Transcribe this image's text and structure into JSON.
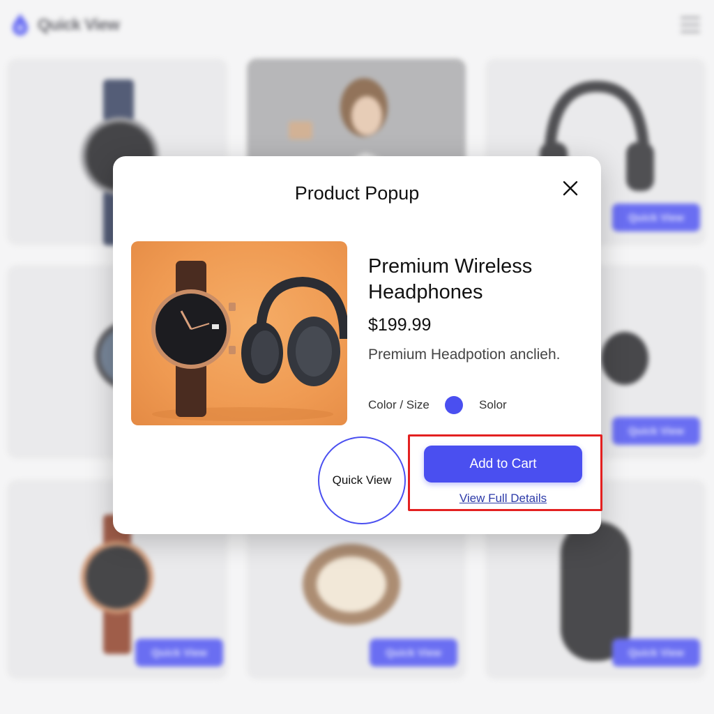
{
  "header": {
    "brand": "Quick View",
    "logo_icon": "droplet-logo-icon",
    "menu_icon": "hamburger-menu-icon"
  },
  "grid": {
    "quick_view_label": "Quick View"
  },
  "modal": {
    "title": "Product Popup",
    "close_icon": "close-icon",
    "product": {
      "name": "Premium Wireless Headphones",
      "price": "$199.99",
      "description": "Premium Headpotion anclieh.",
      "option_label": "Color / Size",
      "option_value": "Solor",
      "swatch_color": "#4a4ff0"
    },
    "quick_view_label": "Quick View",
    "add_to_cart_label": "Add to Cart",
    "view_details_label": "View Full Details"
  },
  "colors": {
    "accent": "#4a4ff0",
    "highlight": "#e32020"
  }
}
